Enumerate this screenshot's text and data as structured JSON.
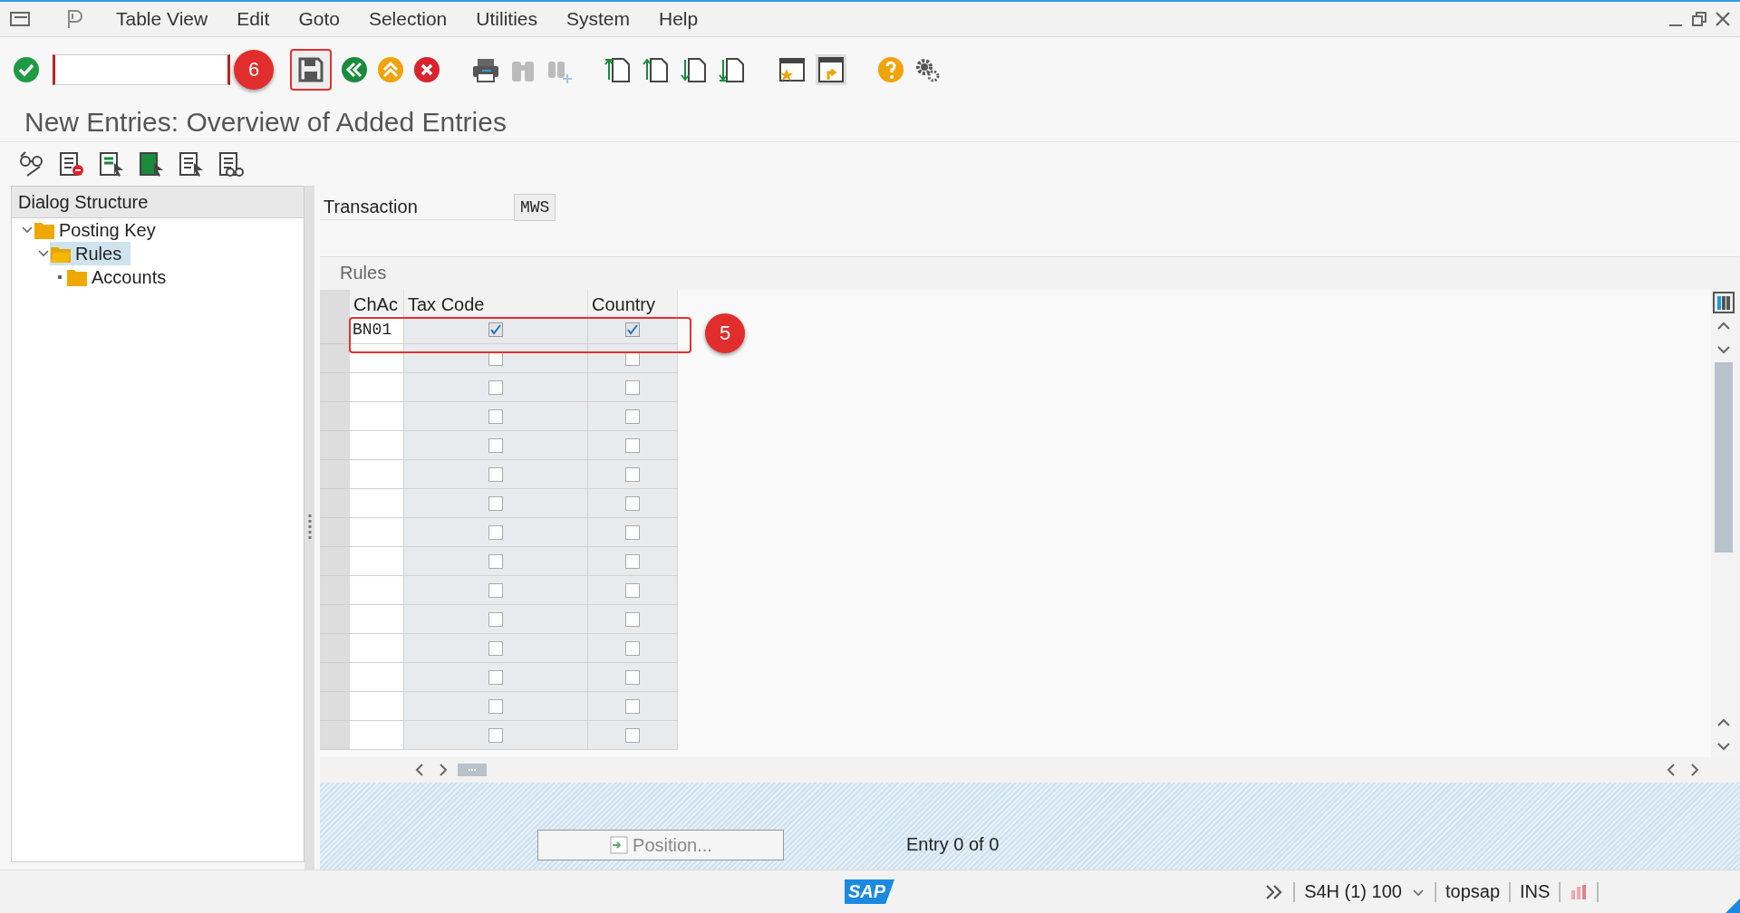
{
  "menu": [
    "Table View",
    "Edit",
    "Goto",
    "Selection",
    "Utilities",
    "System",
    "Help"
  ],
  "toolbar": {
    "callout": "6"
  },
  "title": "New Entries: Overview of Added Entries",
  "tree": {
    "title": "Dialog Structure",
    "items": [
      {
        "label": "Posting Key",
        "expanded": true,
        "selected": false,
        "children": [
          {
            "label": "Rules",
            "expanded": true,
            "selected": true,
            "children": [
              {
                "label": "Accounts",
                "selected": false
              }
            ]
          }
        ]
      }
    ]
  },
  "transaction": {
    "label": "Transaction",
    "value": "MWS"
  },
  "rules": {
    "title": "Rules",
    "columns": [
      "ChAc",
      "Tax Code",
      "Country"
    ],
    "callout": "5",
    "rows": [
      {
        "chac": "BN01",
        "tax_code": true,
        "country": true
      },
      {
        "tax_code": false,
        "country": false
      },
      {
        "tax_code": false,
        "country": false
      },
      {
        "tax_code": false,
        "country": false
      },
      {
        "tax_code": false,
        "country": false
      },
      {
        "tax_code": false,
        "country": false
      },
      {
        "tax_code": false,
        "country": false
      },
      {
        "tax_code": false,
        "country": false
      },
      {
        "tax_code": false,
        "country": false
      },
      {
        "tax_code": false,
        "country": false
      },
      {
        "tax_code": false,
        "country": false
      },
      {
        "tax_code": false,
        "country": false
      },
      {
        "tax_code": false,
        "country": false
      },
      {
        "tax_code": false,
        "country": false
      },
      {
        "tax_code": false,
        "country": false
      }
    ]
  },
  "footer": {
    "position_button": "Position...",
    "entry": "Entry 0 of 0"
  },
  "status_bar": {
    "logo": "SAP",
    "system": "S4H (1) 100",
    "user": "topsap",
    "mode": "INS"
  }
}
